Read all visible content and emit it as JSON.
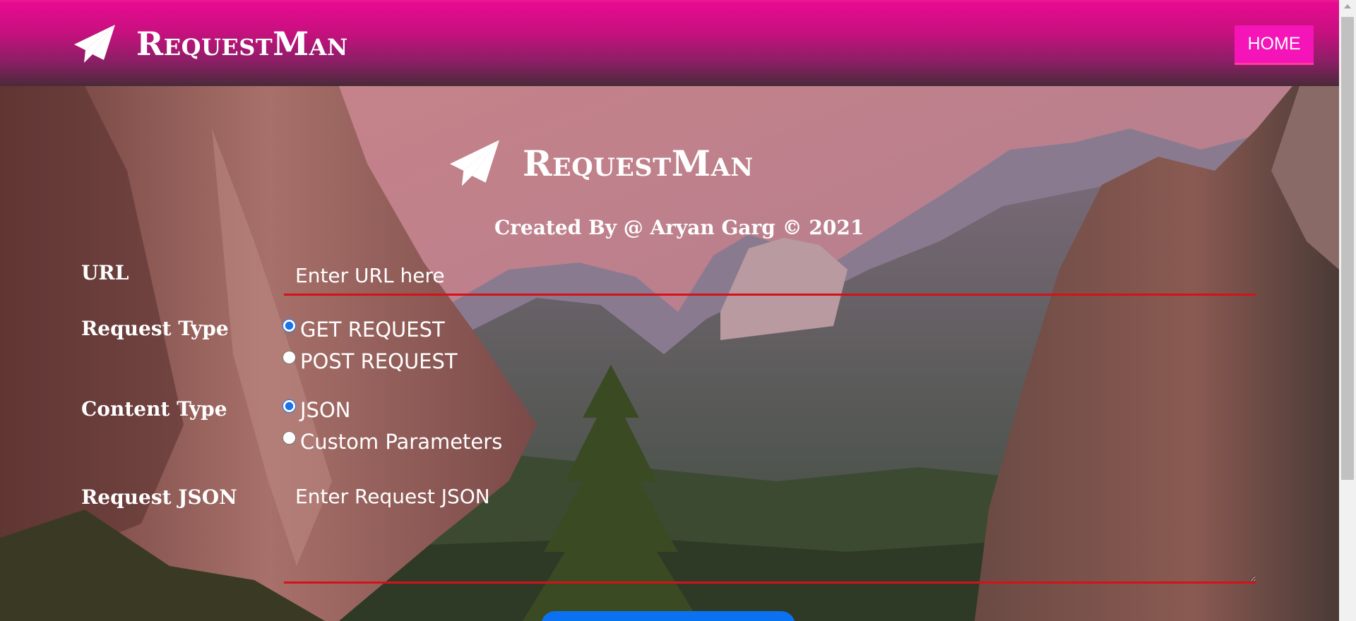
{
  "navbar": {
    "brand": "RequestMan",
    "home_label": "HOME"
  },
  "hero": {
    "title": "RequestMan",
    "credit": "Created By @ Aryan Garg © 2021"
  },
  "form": {
    "url_label": "URL",
    "url_placeholder": "Enter URL here",
    "request_type_label": "Request Type",
    "request_types": [
      "GET REQUEST",
      "POST REQUEST"
    ],
    "request_type_selected": "GET REQUEST",
    "content_type_label": "Content Type",
    "content_types": [
      "JSON",
      "Custom Parameters"
    ],
    "content_type_selected": "JSON",
    "json_label": "Request JSON",
    "json_placeholder": "Enter Request JSON"
  },
  "icons": {
    "brand": "paper-plane-icon"
  },
  "colors": {
    "nav_top": "#e80a92",
    "nav_bottom": "#4a2a3a",
    "home_button": "#f414b8",
    "input_underline": "#d4121a",
    "submit_button": "#0a72f0"
  }
}
